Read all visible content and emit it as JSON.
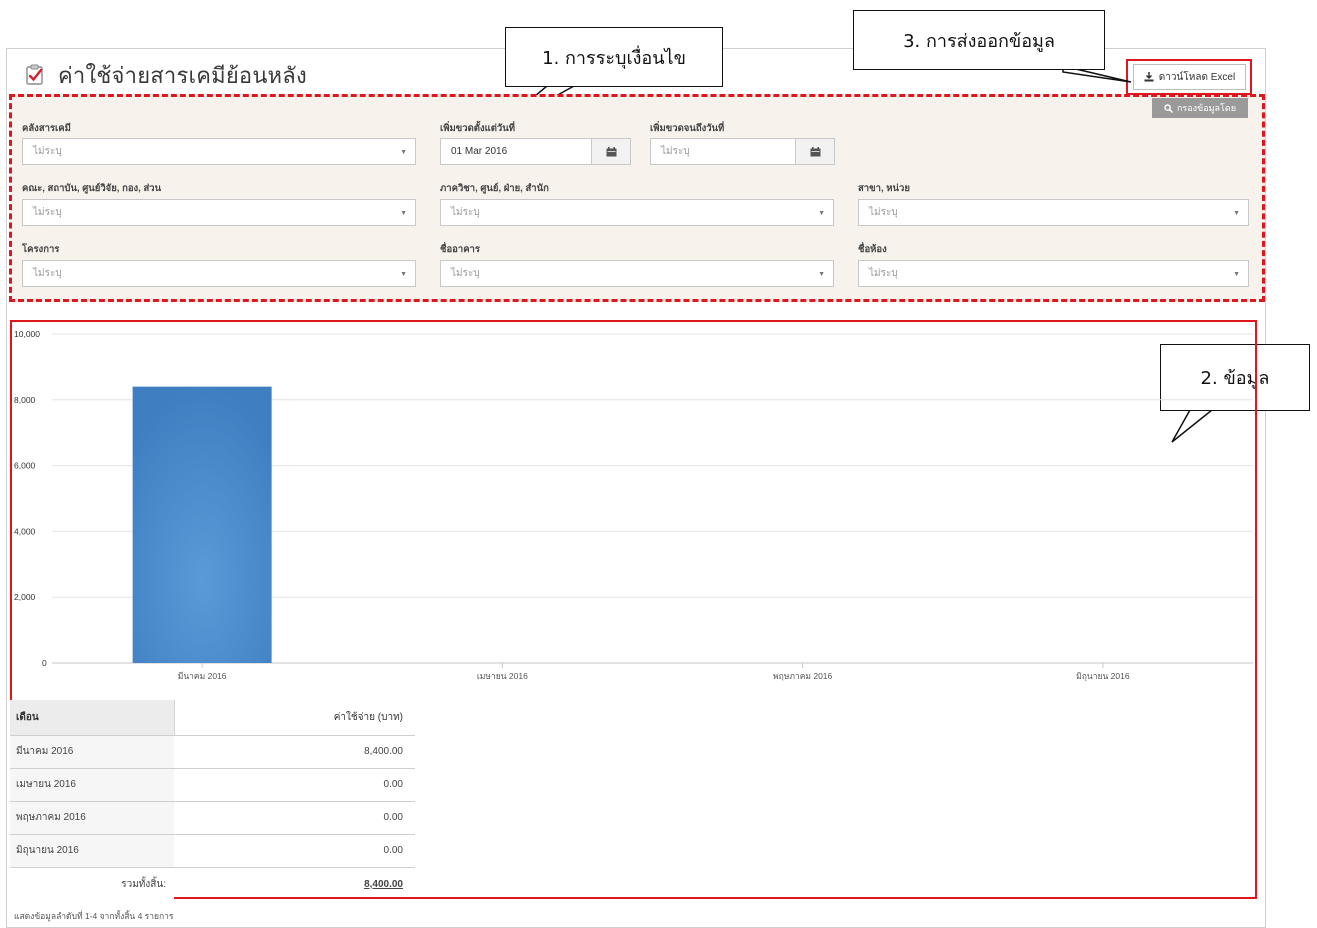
{
  "page": {
    "title": "ค่าใช้จ่ายสารเคมีย้อนหลัง",
    "download_label": "ดาวน์โหลด Excel",
    "filter_button_label": "กรองข้อมูลโดย",
    "footer": "แสดงข้อมูลลำดับที่ 1-4 จากทั้งสิ้น 4 รายการ"
  },
  "callouts": {
    "conditions": "1. การระบุเงื่อนไข",
    "data": "2. ข้อมูล",
    "export": "3. การส่งออกข้อมูล"
  },
  "filters": {
    "placeholder": "ไม่ระบุ",
    "chem_store": {
      "label": "คลังสารเคมี",
      "value": "ไม่ระบุ"
    },
    "date_from": {
      "label": "เพิ่มขวดตั้งแต่วันที่",
      "value": "01 Mar 2016"
    },
    "date_to": {
      "label": "เพิ่มขวดจนถึงวันที่",
      "value": "ไม่ระบุ"
    },
    "faculty": {
      "label": "คณะ, สถาบัน, ศูนย์วิจัย, กอง, ส่วน",
      "value": "ไม่ระบุ"
    },
    "department": {
      "label": "ภาควิชา, ศูนย์, ฝ่าย, สำนัก",
      "value": "ไม่ระบุ"
    },
    "branch": {
      "label": "สาขา, หน่วย",
      "value": "ไม่ระบุ"
    },
    "project": {
      "label": "โครงการ",
      "value": "ไม่ระบุ"
    },
    "building": {
      "label": "ชื่ออาคาร",
      "value": "ไม่ระบุ"
    },
    "room": {
      "label": "ชื่อห้อง",
      "value": "ไม่ระบุ"
    }
  },
  "chart_data": {
    "type": "bar",
    "categories": [
      "มีนาคม 2016",
      "เมษายน 2016",
      "พฤษภาคม 2016",
      "มิถุนายน 2016"
    ],
    "values": [
      8400,
      0,
      0,
      0
    ],
    "ylim": [
      0,
      10000
    ],
    "yticks": [
      "0",
      "2,000",
      "4,000",
      "6,000",
      "8,000",
      "10,000"
    ],
    "grid": true,
    "bar_color": "#3f7fc1"
  },
  "table": {
    "headers": [
      "เดือน",
      "ค่าใช้จ่าย (บาท)"
    ],
    "rows": [
      [
        "มีนาคม 2016",
        "8,400.00"
      ],
      [
        "เมษายน 2016",
        "0.00"
      ],
      [
        "พฤษภาคม 2016",
        "0.00"
      ],
      [
        "มิถุนายน 2016",
        "0.00"
      ]
    ],
    "total_label": "รวมทั้งสิ้น:",
    "total_value": "8,400.00"
  },
  "colors": {
    "highlight": "#e0161f",
    "filter_bg": "#f7f3ec"
  }
}
